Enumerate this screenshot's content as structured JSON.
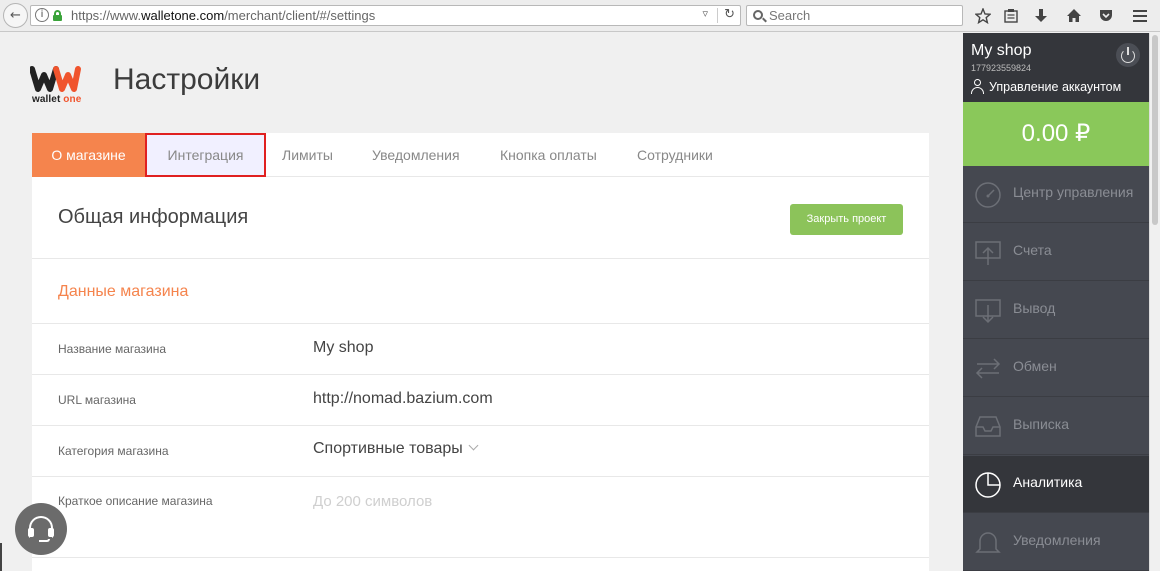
{
  "browser": {
    "url_prefix": "https://www.",
    "url_domain": "walletone.com",
    "url_path": "/merchant/client/#/settings",
    "search_placeholder": "Search"
  },
  "logo": {
    "text_1": "wallet",
    "text_2": "one"
  },
  "page_title": "Настройки",
  "tabs": [
    {
      "label": "О магазине",
      "state": "active"
    },
    {
      "label": "Интеграция",
      "state": "highlighted"
    },
    {
      "label": "Лимиты"
    },
    {
      "label": "Уведомления"
    },
    {
      "label": "Кнопка оплаты"
    },
    {
      "label": "Сотрудники"
    }
  ],
  "section": {
    "title": "Общая информация",
    "close_button": "Закрыть проект",
    "subsection_title": "Данные магазина"
  },
  "fields": [
    {
      "label": "Название магазина",
      "value": "My shop"
    },
    {
      "label": "URL магазина",
      "value": "http://nomad.bazium.com"
    },
    {
      "label": "Категория магазина",
      "value": "Спортивные товары"
    },
    {
      "label": "Краткое описание магазина",
      "placeholder": "До 200 символов"
    }
  ],
  "sidebar": {
    "shop_name": "My shop",
    "shop_id": "177923559824",
    "account_link": "Управление аккаунтом",
    "balance": "0.00 ₽",
    "nav": [
      {
        "label": "Центр управления",
        "icon": "dashboard-icon"
      },
      {
        "label": "Счета",
        "icon": "invoice-icon"
      },
      {
        "label": "Вывод",
        "icon": "withdraw-icon"
      },
      {
        "label": "Обмен",
        "icon": "exchange-icon"
      },
      {
        "label": "Выписка",
        "icon": "statement-icon"
      },
      {
        "label": "Аналитика",
        "icon": "pie-chart-icon",
        "active": true
      },
      {
        "label": "Уведомления",
        "icon": "bell-icon"
      }
    ]
  },
  "colors": {
    "accent_orange": "#f5844d",
    "accent_green": "#8ac85a",
    "sidebar_bg": "#454850",
    "highlight_border": "#e02020"
  }
}
